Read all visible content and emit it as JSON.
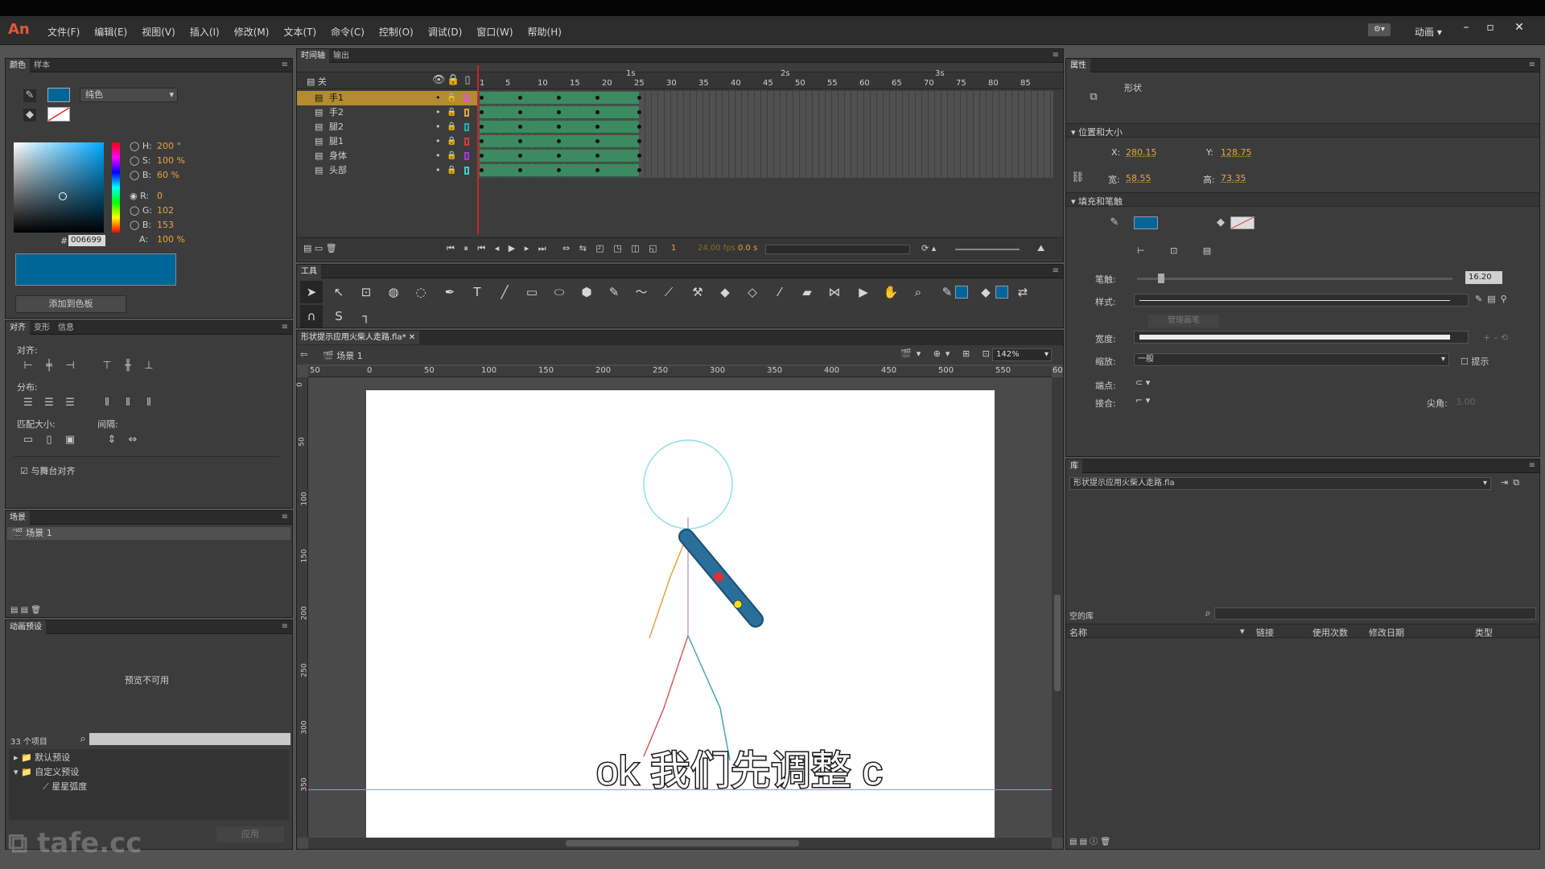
{
  "app": {
    "logo": "An",
    "workspace_label": "动画",
    "workspace_icon": "workspace-switch-icon"
  },
  "menu": [
    "文件(F)",
    "编辑(E)",
    "视图(V)",
    "插入(I)",
    "修改(M)",
    "文本(T)",
    "命令(C)",
    "控制(O)",
    "调试(D)",
    "窗口(W)",
    "帮助(H)"
  ],
  "color_panel": {
    "tabs": [
      "颜色",
      "样本"
    ],
    "fill_type": "纯色",
    "h_label": "H:",
    "h": "200",
    "h_unit": "°",
    "s_label": "S:",
    "s": "100",
    "s_unit": "%",
    "b_label": "B:",
    "b": "60",
    "b_unit": "%",
    "r_label": "R:",
    "r": "0",
    "g_label": "G:",
    "g": "102",
    "bb_label": "B:",
    "bb": "153",
    "a_label": "A:",
    "a": "100",
    "a_unit": "%",
    "hex_label": "#",
    "hex": "006699",
    "swatch_color": "#006699",
    "add_button": "添加到色板"
  },
  "align_panel": {
    "tabs": [
      "对齐",
      "变形",
      "信息"
    ],
    "align": "对齐:",
    "distribute": "分布:",
    "match": "匹配大小:",
    "spacing": "间隔:",
    "stage_check": "与舞台对齐"
  },
  "scene_panel": {
    "tab": "场景",
    "scene": "场景 1"
  },
  "preset_panel": {
    "tab": "动画预设",
    "preview": "预览不可用",
    "count": "33 个项目",
    "folder1": "默认预设",
    "folder2": "自定义预设",
    "item": "星星弧度",
    "apply": "应用"
  },
  "timeline": {
    "tabs": [
      "时间轴",
      "输出"
    ],
    "header_layer": "关",
    "seconds": [
      "1s",
      "2s",
      "3s"
    ],
    "ticks": [
      "1",
      "5",
      "10",
      "15",
      "20",
      "25",
      "30",
      "35",
      "40",
      "45",
      "50",
      "55",
      "60",
      "65",
      "70",
      "75",
      "80",
      "85"
    ],
    "layers": [
      {
        "name": "手1",
        "color": "#e84ee8"
      },
      {
        "name": "手2",
        "color": "#e8a23a"
      },
      {
        "name": "腿2",
        "color": "#22b0b0"
      },
      {
        "name": "腿1",
        "color": "#d83a3a"
      },
      {
        "name": "身体",
        "color": "#a03ad8"
      },
      {
        "name": "头部",
        "color": "#3ad0d0"
      }
    ],
    "fps": "24.00 fps",
    "time": "0.0 s",
    "frame": "1"
  },
  "tools": {
    "tab": "工具",
    "stroke_color": "#006699",
    "fill_color": "#006699"
  },
  "document": {
    "tab": "形状提示应用火柴人走路.fla*",
    "scene": "场景 1",
    "zoom": "142%",
    "hruler": [
      "50",
      "0",
      "50",
      "100",
      "150",
      "200",
      "250",
      "300",
      "350",
      "400",
      "450",
      "500",
      "550",
      "60"
    ],
    "vruler": [
      "0",
      "50",
      "100",
      "150",
      "200",
      "250",
      "300",
      "350"
    ]
  },
  "subtitle": "ok 我们先调整 c",
  "watermark": "tafe.cc",
  "properties": {
    "tab": "属性",
    "type": "形状",
    "section_pos": "位置和大小",
    "x_label": "X:",
    "x": "280.15",
    "y_label": "Y:",
    "y": "128.75",
    "w_label": "宽:",
    "w": "58.55",
    "h_label": "高:",
    "h": "73.35",
    "section_fill": "填充和笔触",
    "stroke_label": "笔触:",
    "stroke_value": "16.20",
    "style_label": "样式:",
    "manage_button": "管理画笔",
    "width_label": "宽度:",
    "scale_label": "缩放:",
    "scale_value": "一般",
    "hint_label": "提示",
    "cap_label": "端点:",
    "join_label": "接合:",
    "miter_label": "尖角:",
    "miter_value": "3.00",
    "stroke_color": "#006699"
  },
  "library": {
    "tab": "库",
    "file": "形状提示应用火柴人走路.fla",
    "empty": "空的库",
    "cols": [
      "名称",
      "链接",
      "使用次数",
      "修改日期",
      "类型"
    ]
  }
}
